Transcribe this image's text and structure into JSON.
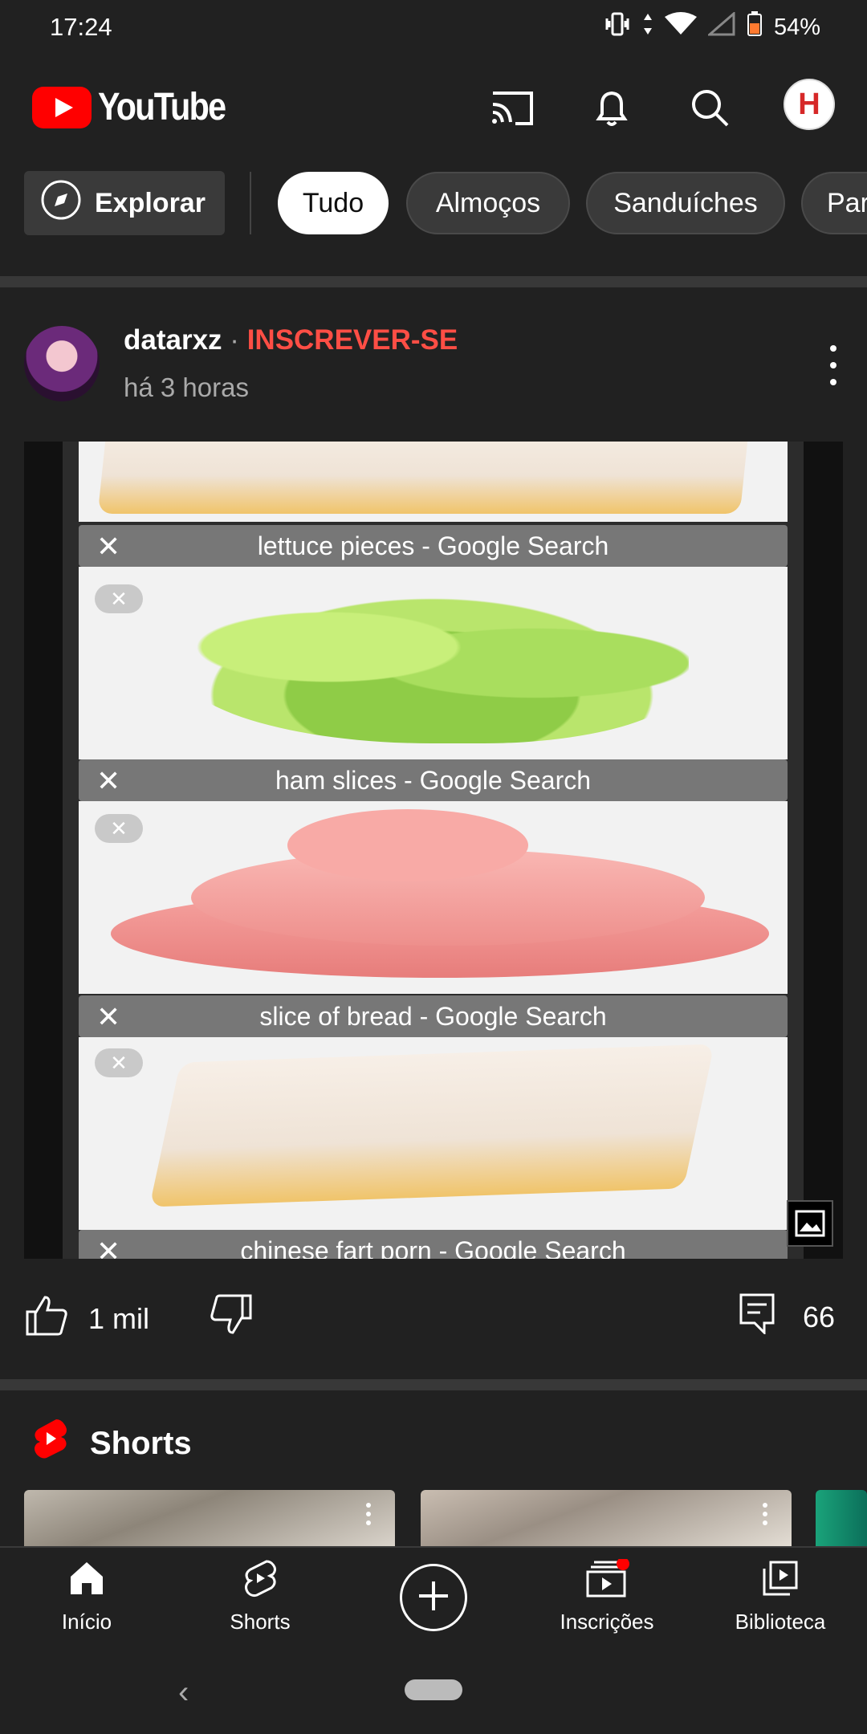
{
  "status_bar": {
    "time": "17:24",
    "battery": "54%"
  },
  "header": {
    "logo_text": "YouTube",
    "account_initial": "H"
  },
  "chips": {
    "explore": "Explorar",
    "items": [
      {
        "label": "Tudo",
        "active": true
      },
      {
        "label": "Almoços",
        "active": false
      },
      {
        "label": "Sanduíches",
        "active": false
      },
      {
        "label": "Par",
        "active": false
      }
    ]
  },
  "post": {
    "channel": "datarxz",
    "separator": "·",
    "subscribe": "INSCREVER-SE",
    "time": "há 3 horas",
    "image_captions": [
      "lettuce pieces - Google Search",
      "ham slices - Google Search",
      "slice of bread - Google Search",
      "chinese fart porn - Google Search"
    ],
    "likes": "1 mil",
    "comments": "66"
  },
  "shorts": {
    "title": "Shorts"
  },
  "bottom_nav": [
    {
      "label": "Início"
    },
    {
      "label": "Shorts"
    },
    {
      "label": "Inscrições"
    },
    {
      "label": "Biblioteca"
    }
  ],
  "colors": {
    "background": "#212121",
    "accent": "#ff0000",
    "subscribe": "#ff4e45"
  }
}
